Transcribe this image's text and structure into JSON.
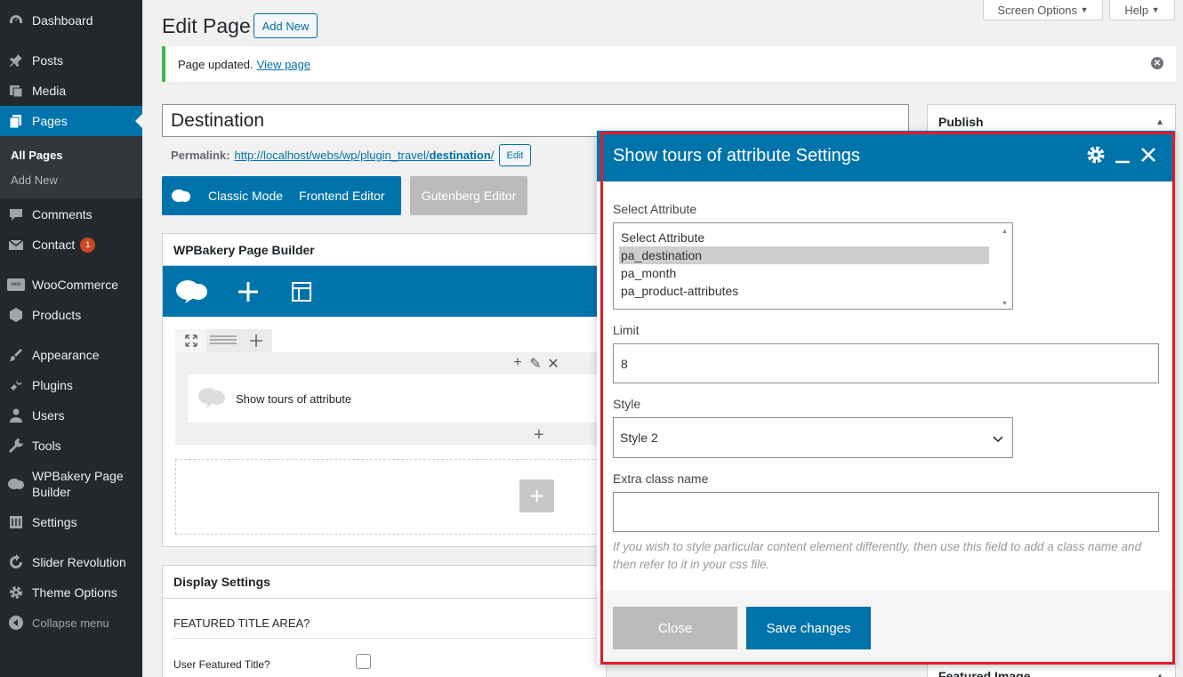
{
  "sidebar": {
    "items": [
      {
        "label": "Dashboard",
        "icon": "dashboard-icon"
      },
      {
        "label": "Posts",
        "icon": "pin-icon"
      },
      {
        "label": "Media",
        "icon": "media-icon"
      },
      {
        "label": "Pages",
        "icon": "pages-icon"
      },
      {
        "label": "Comments",
        "icon": "comment-icon"
      },
      {
        "label": "Contact",
        "icon": "mail-icon",
        "badge": "1"
      },
      {
        "label": "WooCommerce",
        "icon": "woo-icon",
        "icon_text": "woo"
      },
      {
        "label": "Products",
        "icon": "box-icon"
      },
      {
        "label": "Appearance",
        "icon": "brush-icon"
      },
      {
        "label": "Plugins",
        "icon": "plug-icon"
      },
      {
        "label": "Users",
        "icon": "user-icon"
      },
      {
        "label": "Tools",
        "icon": "wrench-icon"
      },
      {
        "label": "WPBakery Page Builder",
        "icon": "wpbakery-icon"
      },
      {
        "label": "Settings",
        "icon": "settings-icon"
      },
      {
        "label": "Slider Revolution",
        "icon": "refresh-icon"
      },
      {
        "label": "Theme Options",
        "icon": "gear-icon"
      },
      {
        "label": "Collapse menu",
        "icon": "collapse-icon"
      }
    ],
    "submenu": [
      "All Pages",
      "Add New"
    ]
  },
  "top": {
    "screen_options": "Screen Options",
    "help": "Help"
  },
  "header": {
    "title": "Edit Page",
    "add_new": "Add New"
  },
  "notice": {
    "text": "Page updated.",
    "link": "View page"
  },
  "post": {
    "title": "Destination",
    "permalink_label": "Permalink:",
    "permalink_base": "http://localhost/webs/wp/plugin_travel/",
    "permalink_slug": "destination",
    "permalink_trail": "/",
    "permalink_edit": "Edit"
  },
  "modes": {
    "classic": "Classic Mode",
    "frontend": "Frontend Editor",
    "gutenberg": "Gutenberg Editor"
  },
  "wpbakery": {
    "title": "WPBakery Page Builder",
    "element_name": "Show tours of attribute"
  },
  "display_settings": {
    "title": "Display Settings",
    "featured_title_area": "FEATURED TITLE AREA?",
    "user_featured_title": "User Featured Title?"
  },
  "right": {
    "publish": "Publish",
    "featured_image": "Featured Image"
  },
  "modal": {
    "title": "Show tours of attribute Settings",
    "select_attribute_label": "Select Attribute",
    "attribute_options": [
      "Select Attribute",
      "pa_destination",
      "pa_month",
      "pa_product-attributes"
    ],
    "selected_attribute": "pa_destination",
    "limit_label": "Limit",
    "limit_value": "8",
    "style_label": "Style",
    "style_value": "Style 2",
    "extra_class_label": "Extra class name",
    "extra_class_value": "",
    "help_text": "If you wish to style particular content element differently, then use this field to add a class name and then refer to it in your css file.",
    "close": "Close",
    "save": "Save changes"
  },
  "colors": {
    "wp_blue": "#0073aa",
    "sidebar": "#23282d",
    "highlight": "#e21b2d",
    "success": "#46b450"
  }
}
